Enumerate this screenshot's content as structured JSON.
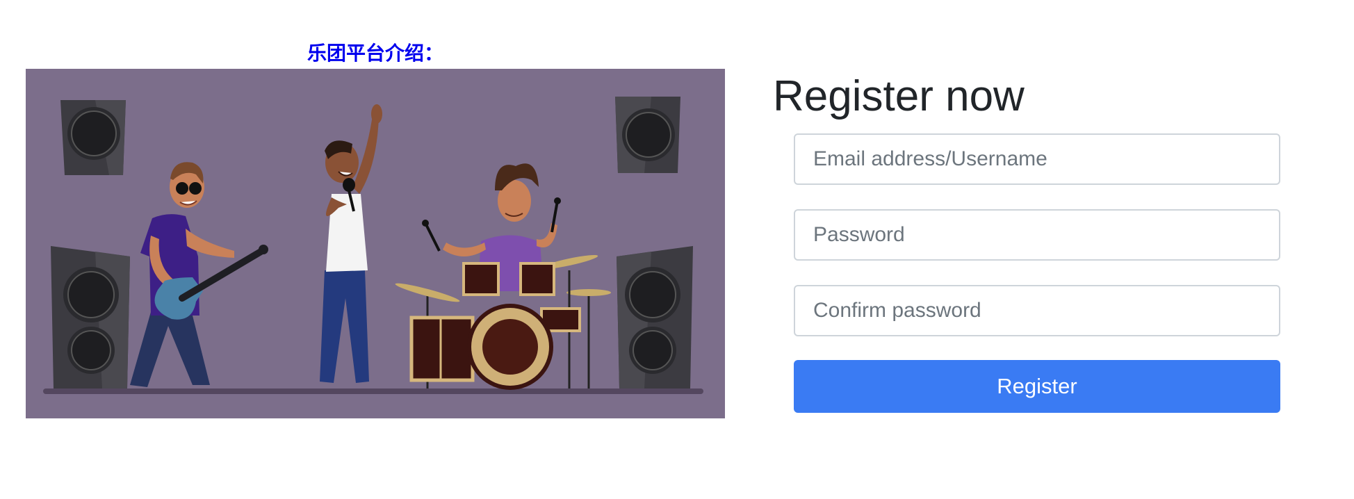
{
  "intro": {
    "title": "乐团平台介绍："
  },
  "illustration": {
    "subject": "band-performing-on-stage"
  },
  "register": {
    "heading": "Register now",
    "email_placeholder": "Email address/Username",
    "password_placeholder": "Password",
    "confirm_placeholder": "Confirm password",
    "button_label": "Register"
  },
  "colors": {
    "stage_bg": "#7c6e8b",
    "button_bg": "#3a7bf3",
    "intro_title": "#0000ee",
    "heading": "#212529"
  }
}
